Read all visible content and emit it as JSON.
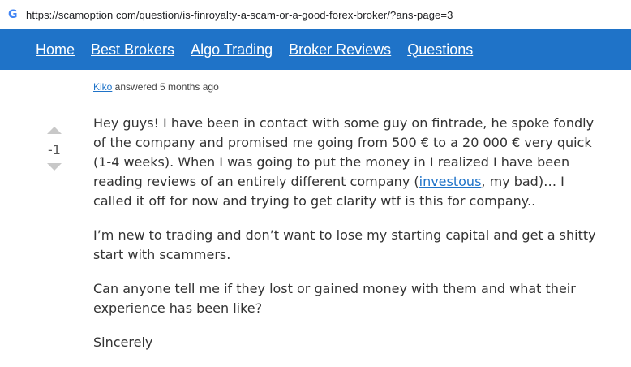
{
  "browser": {
    "url": "https://scamoption com/question/is-finroyalty-a-scam-or-a-good-forex-broker/?ans-page=3",
    "site_icon": "G"
  },
  "nav": {
    "items": [
      "Home",
      "Best Brokers",
      "Algo Trading",
      "Broker Reviews",
      "Questions"
    ]
  },
  "answer": {
    "author": "Kiko",
    "meta": " answered 5 months ago",
    "score": "-1",
    "p1_part1": "Hey guys! I have been in contact with some guy on fintrade, he spoke fondly of the company and promised me going from 500 € to a 20 000 € very quick (1-4 weeks). When I was going to put the money in I realized I have been reading reviews of an entirely different company (",
    "p1_link": "investous",
    "p1_part2": ", my bad)… I called it off for now and trying to get clarity wtf is this for company..",
    "p2": "I’m new to trading and don’t want to lose my starting capital and get a shitty start with scammers.",
    "p3": "Can anyone tell me if they lost or gained money with them and what their experience has been like?",
    "p4": "Sincerely"
  },
  "colors": {
    "nav_bg": "#1f73c8",
    "link": "#1f73c8",
    "vote_arrow": "#c8c8c8"
  }
}
